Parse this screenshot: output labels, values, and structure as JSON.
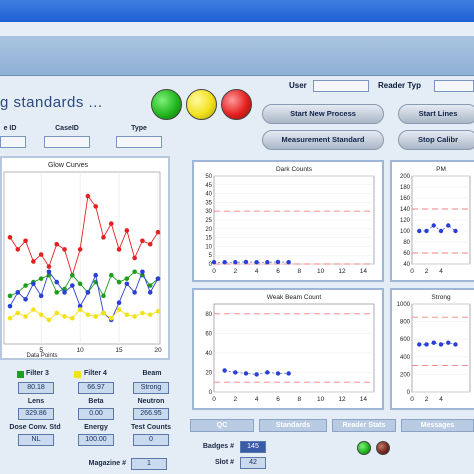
{
  "header": {
    "status_text": "g standards ...",
    "user_label": "User",
    "reader_type_label": "Reader Typ"
  },
  "colors": {
    "red_light": "#e42020",
    "yellow_light": "#f2e21c",
    "green_light": "#22b81e"
  },
  "buttons": {
    "start_new_process": "Start New Process",
    "start_lines": "Start Lines",
    "measurement_standard": "Measurement Standard",
    "stop_calib": "Stop Calibr"
  },
  "id_fields": {
    "id_label": "e ID",
    "caseid_label": "CaseID",
    "type_label": "Type"
  },
  "glow_curves": {
    "title": "Glow Curves",
    "xlabel": "Data Points",
    "x_ticks": [
      "5",
      "10",
      "15",
      "20"
    ]
  },
  "filters": [
    {
      "label": "Filter 3",
      "color": "#1e9e1e",
      "value": "80.18"
    },
    {
      "label": "Filter 4",
      "color": "#f2e21c",
      "value": "66.97"
    },
    {
      "label": "Beam",
      "color": "",
      "value": "Strong"
    }
  ],
  "metrics": [
    {
      "label": "Lens",
      "value": "329.86"
    },
    {
      "label": "Beta",
      "value": "0.00"
    },
    {
      "label": "Neutron",
      "value": "266.95"
    }
  ],
  "doses": [
    {
      "label": "Dose Conv. Std",
      "value": "NL"
    },
    {
      "label": "Energy",
      "value": "100.00"
    },
    {
      "label": "Test Counts",
      "value": "0"
    }
  ],
  "magazine": {
    "label": "Magazine #",
    "value": "1"
  },
  "tabs": [
    "QC",
    "Standards",
    "Reader Stats",
    "Messages"
  ],
  "badges": {
    "badge_label": "Badges #",
    "badge_value": "145",
    "slot_label": "Slot #",
    "slot_value": "42"
  },
  "chart_data": [
    {
      "type": "line",
      "title": "Glow Curves",
      "xlabel": "Data Points",
      "x": [
        1,
        2,
        3,
        4,
        5,
        6,
        7,
        8,
        9,
        10,
        11,
        12,
        13,
        14,
        15,
        16,
        17,
        18,
        19,
        20
      ],
      "series": [
        {
          "color": "#e42020",
          "values": [
            0.62,
            0.55,
            0.6,
            0.48,
            0.52,
            0.45,
            0.58,
            0.55,
            0.4,
            0.55,
            0.86,
            0.8,
            0.62,
            0.7,
            0.55,
            0.66,
            0.5,
            0.6,
            0.58,
            0.65
          ]
        },
        {
          "color": "#1e9e1e",
          "values": [
            0.28,
            0.3,
            0.34,
            0.36,
            0.38,
            0.4,
            0.3,
            0.32,
            0.4,
            0.35,
            0.3,
            0.36,
            0.28,
            0.4,
            0.36,
            0.38,
            0.42,
            0.4,
            0.34,
            0.38
          ]
        },
        {
          "color": "#2a3fd6",
          "values": [
            0.22,
            0.3,
            0.26,
            0.35,
            0.28,
            0.42,
            0.36,
            0.3,
            0.34,
            0.22,
            0.3,
            0.4,
            0.18,
            0.14,
            0.24,
            0.35,
            0.3,
            0.42,
            0.3,
            0.38
          ]
        },
        {
          "color": "#f2e21c",
          "values": [
            0.15,
            0.18,
            0.16,
            0.2,
            0.17,
            0.14,
            0.18,
            0.16,
            0.15,
            0.2,
            0.17,
            0.16,
            0.18,
            0.15,
            0.2,
            0.17,
            0.16,
            0.18,
            0.17,
            0.19
          ]
        }
      ]
    },
    {
      "type": "scatter",
      "title": "Dark Counts",
      "xlim": [
        0,
        15
      ],
      "ylim": [
        0,
        50
      ],
      "x_ticks": [
        "0",
        "2",
        "4",
        "6",
        "8",
        "10",
        "12",
        "14"
      ],
      "y_ticks": [
        "0",
        "5",
        "10",
        "15",
        "20",
        "25",
        "30",
        "35",
        "40",
        "45",
        "50"
      ],
      "limit_lines": [
        30,
        0
      ],
      "points": [
        [
          0,
          1
        ],
        [
          1,
          1
        ],
        [
          2,
          1
        ],
        [
          3,
          1.2
        ],
        [
          4,
          1
        ],
        [
          5,
          1
        ],
        [
          6,
          1.2
        ],
        [
          7,
          1
        ]
      ]
    },
    {
      "type": "scatter",
      "title": "PM",
      "xlim": [
        0,
        8
      ],
      "ylim": [
        40,
        200
      ],
      "x_ticks": [
        "0",
        "2",
        "4"
      ],
      "y_ticks": [
        "40",
        "60",
        "80",
        "100",
        "120",
        "140",
        "160",
        "180",
        "200"
      ],
      "limit_lines": [
        140,
        60
      ],
      "points": [
        [
          1,
          100
        ],
        [
          2,
          100
        ],
        [
          3,
          110
        ],
        [
          4,
          100
        ],
        [
          5,
          110
        ],
        [
          6,
          100
        ]
      ]
    },
    {
      "type": "scatter",
      "title": "Weak Beam Count",
      "xlim": [
        0,
        15
      ],
      "ylim": [
        0,
        90
      ],
      "x_ticks": [
        "0",
        "2",
        "4",
        "6",
        "8",
        "10",
        "12",
        "14"
      ],
      "y_ticks": [
        "0",
        "20",
        "40",
        "60",
        "80"
      ],
      "limit_lines": [
        80,
        10
      ],
      "points": [
        [
          1,
          22
        ],
        [
          2,
          20
        ],
        [
          3,
          19
        ],
        [
          4,
          18
        ],
        [
          5,
          20
        ],
        [
          6,
          19
        ],
        [
          7,
          19
        ]
      ]
    },
    {
      "type": "scatter",
      "title": "Strong",
      "xlim": [
        0,
        8
      ],
      "ylim": [
        0,
        1000
      ],
      "x_ticks": [
        "0",
        "2",
        "4"
      ],
      "y_ticks": [
        "0",
        "200",
        "400",
        "600",
        "800",
        "1000"
      ],
      "limit_lines": [
        850,
        300
      ],
      "points": [
        [
          1,
          540
        ],
        [
          2,
          540
        ],
        [
          3,
          560
        ],
        [
          4,
          540
        ],
        [
          5,
          560
        ],
        [
          6,
          540
        ]
      ]
    }
  ]
}
